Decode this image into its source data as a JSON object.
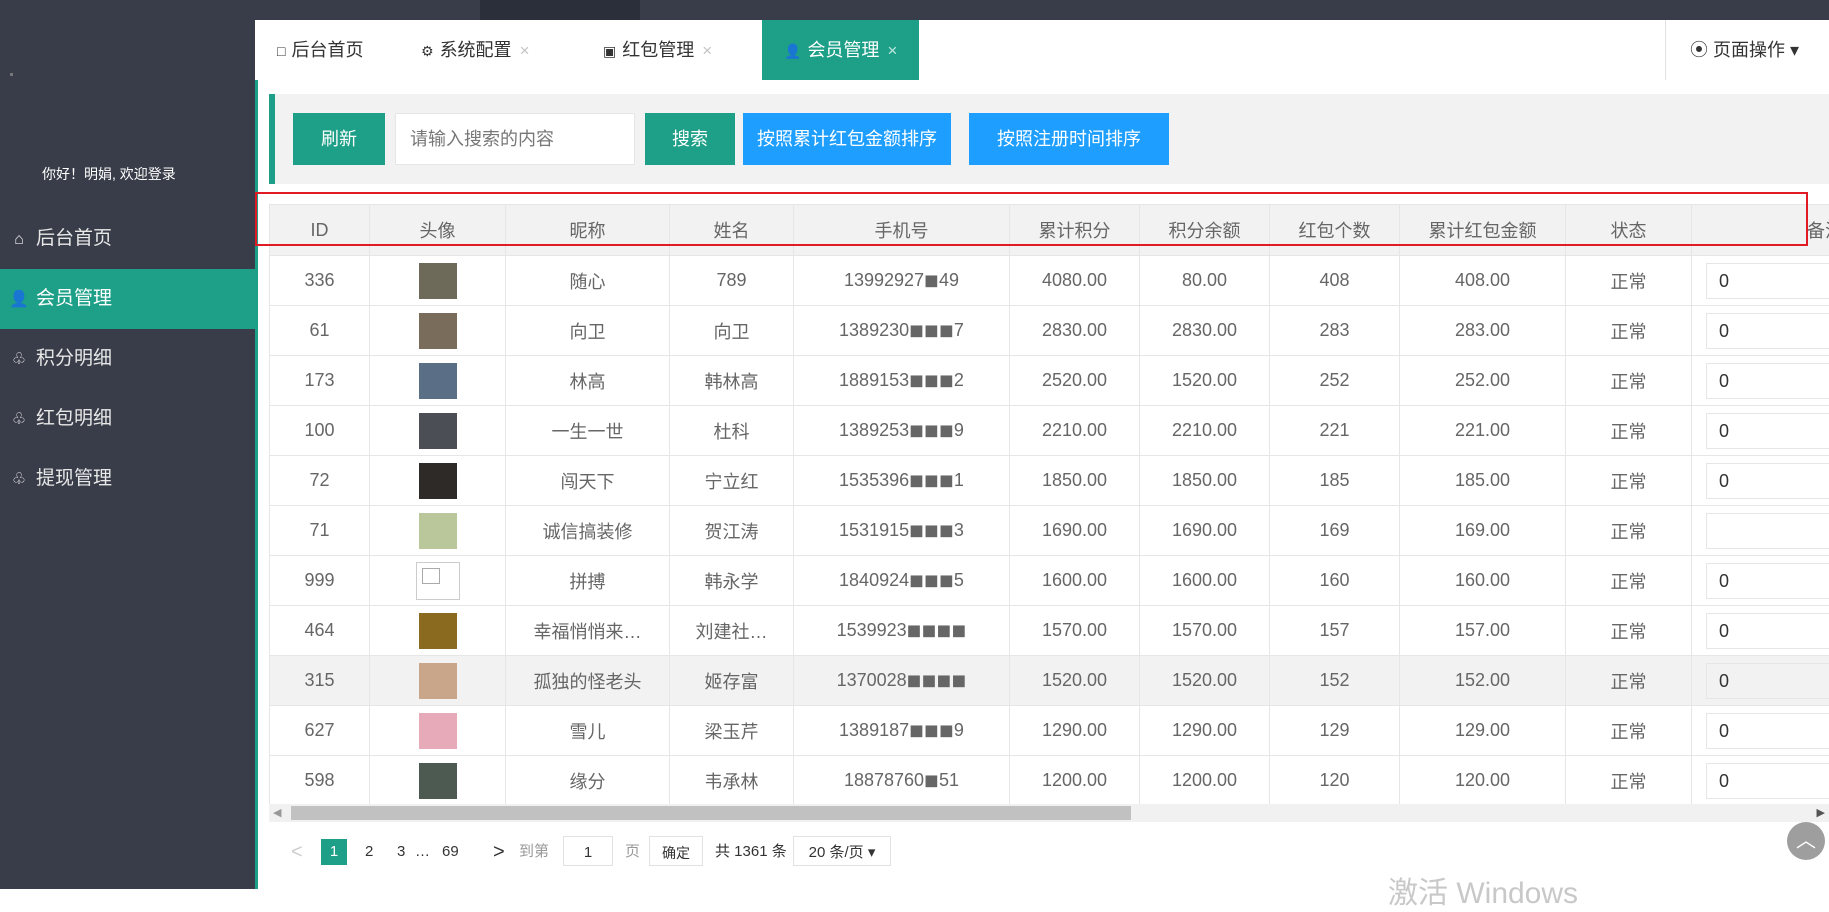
{
  "sidebar": {
    "welcome": "你好！明娟, 欢迎登录",
    "items": [
      {
        "icon": "home-outline-icon",
        "glyph": "⌂",
        "label": "后台首页"
      },
      {
        "icon": "user-icon",
        "glyph": "👤",
        "label": "会员管理"
      },
      {
        "icon": "medal-icon",
        "glyph": "♧",
        "label": "积分明细"
      },
      {
        "icon": "medal-icon",
        "glyph": "♧",
        "label": "红包明细"
      },
      {
        "icon": "medal-icon",
        "glyph": "♧",
        "label": "提现管理"
      }
    ]
  },
  "tabs": [
    {
      "label": "后台首页",
      "icon": "□",
      "closable": false
    },
    {
      "label": "系统配置",
      "icon": "⚙",
      "closable": true
    },
    {
      "label": "红包管理",
      "icon": "▣",
      "closable": true
    },
    {
      "label": "会员管理",
      "icon": "👤",
      "closable": true
    }
  ],
  "tab_close": "×",
  "page_op": "⦿ 页面操作 ▾",
  "toolbar": {
    "refresh": "刷新",
    "search_placeholder": "请输入搜索的内容",
    "search": "搜索",
    "sort_redpack": "按照累计红包金额排序",
    "sort_regtime": "按照注册时间排序"
  },
  "table": {
    "headers": [
      "ID",
      "头像",
      "昵称",
      "姓名",
      "手机号",
      "累计积分",
      "积分余额",
      "红包个数",
      "累计红包金额",
      "状态",
      "备注"
    ],
    "rows": [
      {
        "id": "336",
        "avatar": "#6e6a5a",
        "nick": "随心",
        "name": "789",
        "phone": "13992927◼49",
        "total": "4080.00",
        "balance": "80.00",
        "count": "408",
        "amount": "408.00",
        "status": "正常",
        "memo": "0"
      },
      {
        "id": "61",
        "avatar": "#7a6c5a",
        "nick": "向卫",
        "name": "向卫",
        "phone": "1389230◼◼◼7",
        "total": "2830.00",
        "balance": "2830.00",
        "count": "283",
        "amount": "283.00",
        "status": "正常",
        "memo": "0"
      },
      {
        "id": "173",
        "avatar": "#5a6f86",
        "nick": "林高",
        "name": "韩林高",
        "phone": "1889153◼◼◼2",
        "total": "2520.00",
        "balance": "1520.00",
        "count": "252",
        "amount": "252.00",
        "status": "正常",
        "memo": "0"
      },
      {
        "id": "100",
        "avatar": "#4b4f55",
        "nick": "一生一世",
        "name": "杜科",
        "phone": "1389253◼◼◼9",
        "total": "2210.00",
        "balance": "2210.00",
        "count": "221",
        "amount": "221.00",
        "status": "正常",
        "memo": "0"
      },
      {
        "id": "72",
        "avatar": "#2e2a28",
        "nick": "闯天下",
        "name": "宁立红",
        "phone": "1535396◼◼◼1",
        "total": "1850.00",
        "balance": "1850.00",
        "count": "185",
        "amount": "185.00",
        "status": "正常",
        "memo": "0"
      },
      {
        "id": "71",
        "avatar": "#b9c79a",
        "nick": "诚信搞装修",
        "name": "贺江涛",
        "phone": "1531915◼◼◼3",
        "total": "1690.00",
        "balance": "1690.00",
        "count": "169",
        "amount": "169.00",
        "status": "正常",
        "memo": ""
      },
      {
        "id": "999",
        "avatar": "blank",
        "nick": "拼搏",
        "name": "韩永学",
        "phone": "1840924◼◼◼5",
        "total": "1600.00",
        "balance": "1600.00",
        "count": "160",
        "amount": "160.00",
        "status": "正常",
        "memo": "0"
      },
      {
        "id": "464",
        "avatar": "#8a6a1e",
        "nick": "幸福悄悄来…",
        "name": "刘建社…",
        "phone": "1539923◼◼◼◼",
        "total": "1570.00",
        "balance": "1570.00",
        "count": "157",
        "amount": "157.00",
        "status": "正常",
        "memo": "0"
      },
      {
        "id": "315",
        "avatar": "#c9a58a",
        "nick": "孤独的怪老头",
        "name": "姬存富",
        "phone": "1370028◼◼◼◼",
        "total": "1520.00",
        "balance": "1520.00",
        "count": "152",
        "amount": "152.00",
        "status": "正常",
        "memo": "0"
      },
      {
        "id": "627",
        "avatar": "#e7aab8",
        "nick": "雪儿",
        "name": "梁玉芹",
        "phone": "1389187◼◼◼9",
        "total": "1290.00",
        "balance": "1290.00",
        "count": "129",
        "amount": "129.00",
        "status": "正常",
        "memo": "0"
      },
      {
        "id": "598",
        "avatar": "#4d5a52",
        "nick": "缘分",
        "name": "韦承林",
        "phone": "18878760◼51",
        "total": "1200.00",
        "balance": "1200.00",
        "count": "120",
        "amount": "120.00",
        "status": "正常",
        "memo": "0"
      }
    ]
  },
  "pager": {
    "prev": "<",
    "current": "1",
    "p2": "2",
    "p3": "3",
    "ellipsis": "…",
    "last": "69",
    "next": ">",
    "goto_label": "到第",
    "goto_value": "1",
    "page_unit": "页",
    "confirm": "确定",
    "total": "共 1361 条",
    "page_size": "20 条/页 ▾"
  },
  "back_top": "︿",
  "watermark": "激活 Windows"
}
